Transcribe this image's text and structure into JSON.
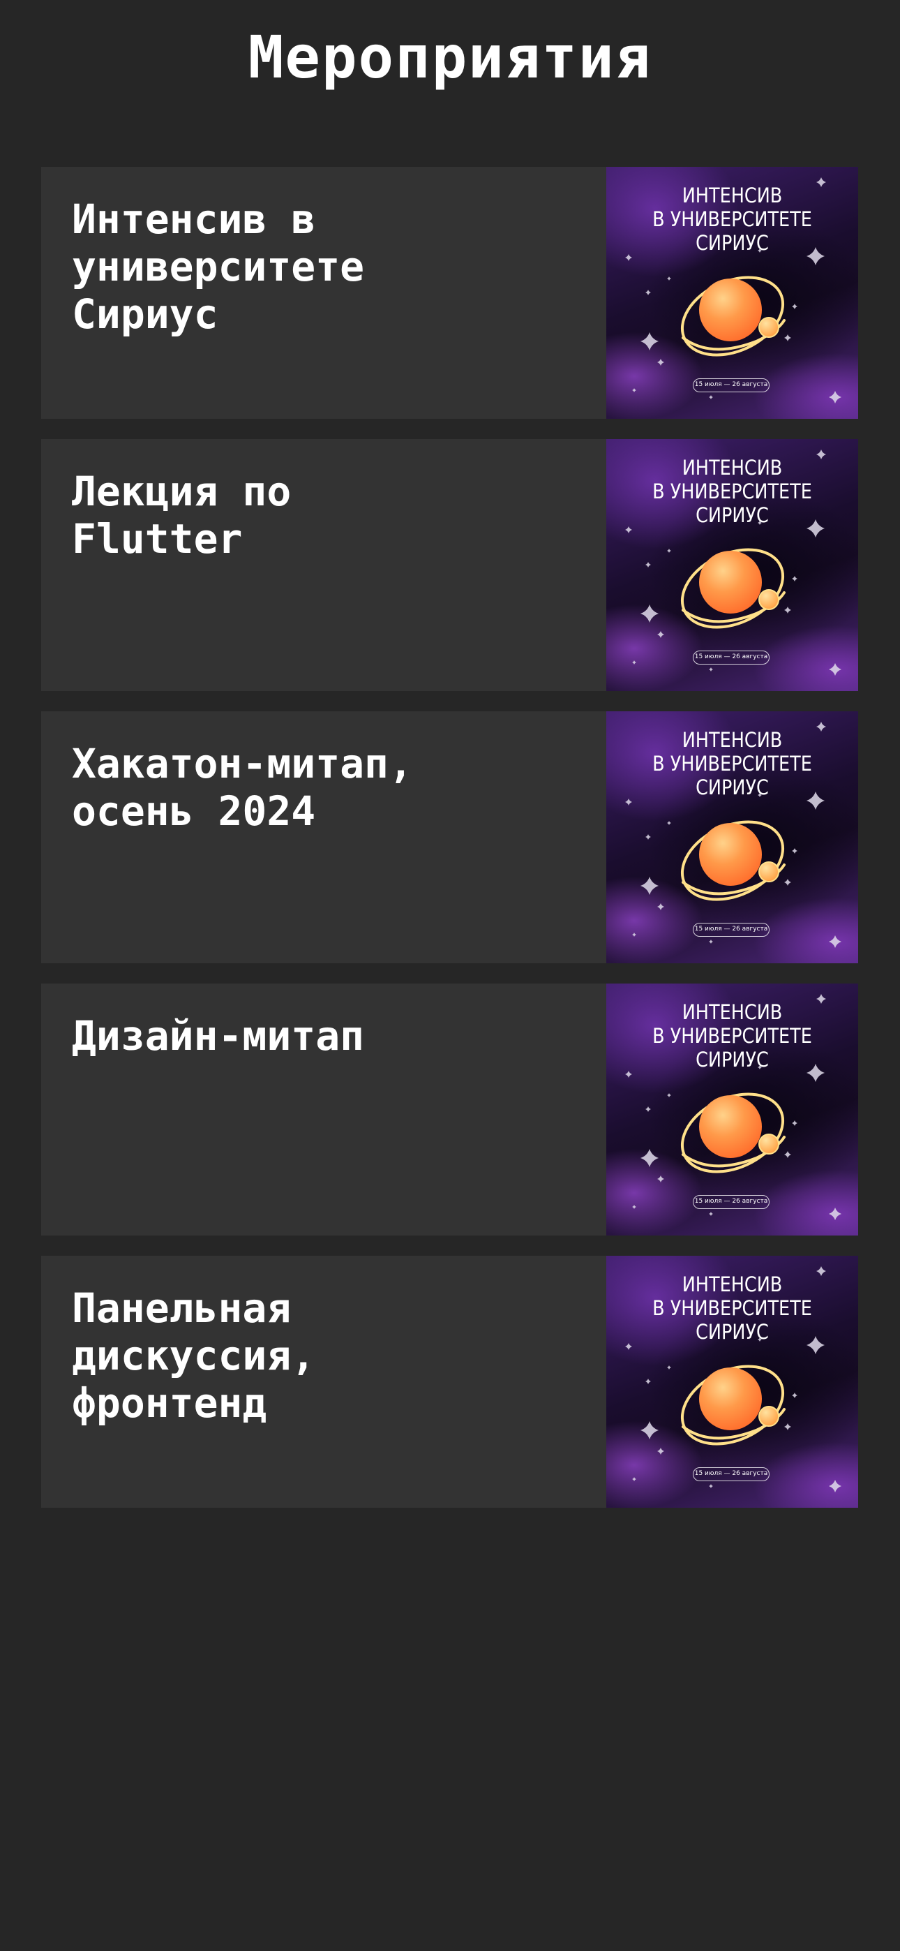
{
  "page": {
    "title": "Мероприятия"
  },
  "events": [
    {
      "title": "Интенсив в\nуниверситете\nСириус",
      "cover": {
        "heading": "ИНТЕНСИВ\nВ УНИВЕРСИТЕТЕ\nСИРИУС",
        "dates": "15 июля — 26 августа"
      }
    },
    {
      "title": "Лекция по\nFlutter",
      "cover": {
        "heading": "ИНТЕНСИВ\nВ УНИВЕРСИТЕТЕ\nСИРИУС",
        "dates": "15 июля — 26 августа"
      }
    },
    {
      "title": "Хакатон-митап,\nосень 2024",
      "cover": {
        "heading": "ИНТЕНСИВ\nВ УНИВЕРСИТЕТЕ\nСИРИУС",
        "dates": "15 июля — 26 августа"
      }
    },
    {
      "title": "Дизайн-митап",
      "cover": {
        "heading": "ИНТЕНСИВ\nВ УНИВЕРСИТЕТЕ\nСИРИУС",
        "dates": "15 июля — 26 августа"
      }
    },
    {
      "title": "Панельная\nдискуссия,\nфронтенд",
      "cover": {
        "heading": "ИНТЕНСИВ\nВ УНИВЕРСИТЕТЕ\nСИРИУС",
        "dates": "15 июля — 26 августа"
      }
    }
  ],
  "colors": {
    "background": "#262626",
    "card": "#333333",
    "text": "#ffffff",
    "cover_purple": "#4b2677",
    "planet_orange": "#ff6a2a",
    "orbit_yellow": "#ffe08a"
  },
  "icons": {
    "planet": "planet-icon",
    "sparkle": "sparkle-icon"
  }
}
